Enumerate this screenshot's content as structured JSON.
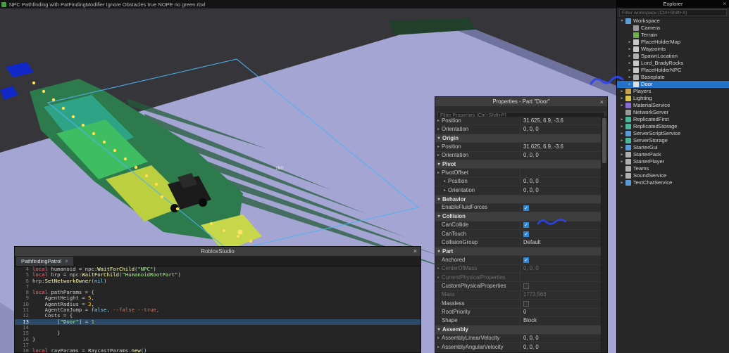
{
  "title_bar": {
    "title": "NPC Pathfinding with PatFindingModifier Ignore Obstacles true NOPE no green.rbxl"
  },
  "viewport": {
    "size_label": "160"
  },
  "script_editor": {
    "window_title": "RobloxStudio",
    "close_label": "×",
    "tab_label": "PathfindingPatrol",
    "tab_close": "×",
    "current_line": "13",
    "lines": [
      {
        "n": "4",
        "seg": [
          [
            "local",
            "kw"
          ],
          [
            " humanoid = npc:",
            "pl"
          ],
          [
            "WaitForChild",
            "fn"
          ],
          [
            "(",
            "pl"
          ],
          [
            "\"NPC\"",
            "str"
          ],
          [
            ")",
            "pl"
          ]
        ]
      },
      {
        "n": "5",
        "seg": [
          [
            "local",
            "kw"
          ],
          [
            " hrp = npc:",
            "pl"
          ],
          [
            "WaitForChild",
            "fn"
          ],
          [
            "(",
            "pl"
          ],
          [
            "\"HumanoidRootPart\"",
            "str"
          ],
          [
            ")",
            "pl"
          ]
        ]
      },
      {
        "n": "6",
        "seg": [
          [
            "hrp:",
            "pl"
          ],
          [
            "SetNetworkOwner",
            "fn"
          ],
          [
            "(",
            "pl"
          ],
          [
            "nil",
            "bool"
          ],
          [
            ")",
            "pl"
          ]
        ]
      },
      {
        "n": "7",
        "seg": [
          [
            "",
            "pl"
          ]
        ]
      },
      {
        "n": "8",
        "seg": [
          [
            "local",
            "kw"
          ],
          [
            " pathParams = {",
            "pl"
          ]
        ]
      },
      {
        "n": "9",
        "seg": [
          [
            "    AgentHeight = ",
            "pl"
          ],
          [
            "5",
            "num"
          ],
          [
            ",",
            "pl"
          ]
        ]
      },
      {
        "n": "10",
        "seg": [
          [
            "    AgentRadius = ",
            "pl"
          ],
          [
            "3",
            "num"
          ],
          [
            ",",
            "pl"
          ]
        ]
      },
      {
        "n": "11",
        "seg": [
          [
            "    AgentCanJump = ",
            "pl"
          ],
          [
            "false",
            "bool"
          ],
          [
            ", ",
            "pl"
          ],
          [
            "--false --true,",
            "com"
          ]
        ]
      },
      {
        "n": "12",
        "seg": [
          [
            "    Costs = {",
            "pl"
          ]
        ]
      },
      {
        "n": "13",
        "seg": [
          [
            "        [",
            "pl"
          ],
          [
            "\"Door\"",
            "str"
          ],
          [
            "] = ",
            "pl"
          ],
          [
            "1",
            "num"
          ]
        ]
      },
      {
        "n": "14",
        "seg": [
          [
            "",
            "pl"
          ]
        ]
      },
      {
        "n": "15",
        "seg": [
          [
            "        }",
            "pl"
          ]
        ]
      },
      {
        "n": "16",
        "seg": [
          [
            "}",
            "pl"
          ]
        ]
      },
      {
        "n": "17",
        "seg": [
          [
            "",
            "pl"
          ]
        ]
      },
      {
        "n": "18",
        "seg": [
          [
            "local",
            "kw"
          ],
          [
            " rayParams = RaycastParams.",
            "pl"
          ],
          [
            "new",
            "fn"
          ],
          [
            "()",
            "pl"
          ]
        ]
      }
    ]
  },
  "properties_panel": {
    "title": "Properties - Part \"Door\"",
    "close_label": "×",
    "filter_placeholder": "Filter Properties (Ctrl+Shift+P)",
    "rows": [
      {
        "t": "p",
        "name": "Position",
        "val": "31.625, 6.9, -3.6",
        "arr": true
      },
      {
        "t": "p",
        "name": "Orientation",
        "val": "0, 0, 0",
        "arr": true
      },
      {
        "t": "s",
        "name": "Origin"
      },
      {
        "t": "p",
        "name": "Position",
        "val": "31.625, 6.9, -3.6",
        "arr": true
      },
      {
        "t": "p",
        "name": "Orientation",
        "val": "0, 0, 0",
        "arr": true
      },
      {
        "t": "s",
        "name": "Pivot"
      },
      {
        "t": "p",
        "name": "PivotOffset",
        "val": "",
        "arr": true
      },
      {
        "t": "p",
        "name": "Position",
        "val": "0, 0, 0",
        "arr": true,
        "ind": 1
      },
      {
        "t": "p",
        "name": "Orientation",
        "val": "0, 0, 0",
        "arr": true,
        "ind": 1
      },
      {
        "t": "s",
        "name": "Behavior"
      },
      {
        "t": "p",
        "name": "EnableFluidForces",
        "chk": true
      },
      {
        "t": "s",
        "name": "Collision"
      },
      {
        "t": "p",
        "name": "CanCollide",
        "chk": true
      },
      {
        "t": "p",
        "name": "CanTouch",
        "chk": true
      },
      {
        "t": "p",
        "name": "CollisionGroup",
        "val": "Default"
      },
      {
        "t": "s",
        "name": "Part"
      },
      {
        "t": "p",
        "name": "Anchored",
        "chk": true
      },
      {
        "t": "p",
        "name": "CenterOfMass",
        "val": "0, 0, 0",
        "arr": true,
        "gray": true
      },
      {
        "t": "p",
        "name": "CurrentPhysicalProperties",
        "val": "",
        "arr": true,
        "gray": true
      },
      {
        "t": "p",
        "name": "CustomPhysicalProperties",
        "chk": false
      },
      {
        "t": "p",
        "name": "Mass",
        "val": "1773.563",
        "gray": true
      },
      {
        "t": "p",
        "name": "Massless",
        "chk": false
      },
      {
        "t": "p",
        "name": "RootPriority",
        "val": "0"
      },
      {
        "t": "p",
        "name": "Shape",
        "val": "Block"
      },
      {
        "t": "s",
        "name": "Assembly"
      },
      {
        "t": "p",
        "name": "AssemblyLinearVelocity",
        "val": "0, 0, 0",
        "arr": true
      },
      {
        "t": "p",
        "name": "AssemblyAngularVelocity",
        "val": "0, 0, 0",
        "arr": true
      }
    ]
  },
  "explorer": {
    "title": "Explorer",
    "close_label": "×",
    "filter_placeholder": "Filter workspace (Ctrl+Shift+X)",
    "items": [
      {
        "label": "Workspace",
        "ind": 0,
        "arr": "d",
        "ic": "workspace-icon",
        "c": "#58a0d6"
      },
      {
        "label": "Camera",
        "ind": 1,
        "arr": "",
        "ic": "camera-icon",
        "c": "#9a9a9a"
      },
      {
        "label": "Terrain",
        "ind": 1,
        "arr": "",
        "ic": "terrain-icon",
        "c": "#6fae4e"
      },
      {
        "label": "PlaceHolderMap",
        "ind": 1,
        "arr": "r",
        "ic": "model-icon",
        "c": "#c8c8c8"
      },
      {
        "label": "Waypoints",
        "ind": 1,
        "arr": "r",
        "ic": "model-icon",
        "c": "#c8c8c8"
      },
      {
        "label": "SpawnLocation",
        "ind": 1,
        "arr": "r",
        "ic": "spawn-location-icon",
        "c": "#b0b0b0"
      },
      {
        "label": "Lord_BradyRocks",
        "ind": 1,
        "arr": "r",
        "ic": "model-icon",
        "c": "#c8c8c8"
      },
      {
        "label": "PlaceHolderNPC",
        "ind": 1,
        "arr": "r",
        "ic": "model-icon",
        "c": "#c8c8c8"
      },
      {
        "label": "Baseplate",
        "ind": 1,
        "arr": "r",
        "ic": "part-icon",
        "c": "#b0b0b0"
      },
      {
        "label": "Door",
        "ind": 1,
        "arr": "r",
        "ic": "part-icon",
        "c": "#e0e0e0",
        "sel": true
      },
      {
        "label": "Players",
        "ind": 0,
        "arr": "r",
        "ic": "players-icon",
        "c": "#c8a24a"
      },
      {
        "label": "Lighting",
        "ind": 0,
        "arr": "r",
        "ic": "lighting-icon",
        "c": "#d6c44e"
      },
      {
        "label": "MaterialService",
        "ind": 0,
        "arr": "r",
        "ic": "material-service-icon",
        "c": "#8a6ad6"
      },
      {
        "label": "NetworkServer",
        "ind": 0,
        "arr": "",
        "ic": "network-server-icon",
        "c": "#9a9a9a"
      },
      {
        "label": "ReplicatedFirst",
        "ind": 0,
        "arr": "r",
        "ic": "replicated-first-icon",
        "c": "#49b89a"
      },
      {
        "label": "ReplicatedStorage",
        "ind": 0,
        "arr": "r",
        "ic": "replicated-storage-icon",
        "c": "#49b89a"
      },
      {
        "label": "ServerScriptService",
        "ind": 0,
        "arr": "r",
        "ic": "server-script-service-icon",
        "c": "#5a9ad8"
      },
      {
        "label": "ServerStorage",
        "ind": 0,
        "arr": "r",
        "ic": "server-storage-icon",
        "c": "#49b89a"
      },
      {
        "label": "StarterGui",
        "ind": 0,
        "arr": "r",
        "ic": "starter-gui-icon",
        "c": "#5a9ad8"
      },
      {
        "label": "StarterPack",
        "ind": 0,
        "arr": "r",
        "ic": "starter-pack-icon",
        "c": "#b0b0b0"
      },
      {
        "label": "StarterPlayer",
        "ind": 0,
        "arr": "r",
        "ic": "starter-player-icon",
        "c": "#b0b0b0"
      },
      {
        "label": "Teams",
        "ind": 0,
        "arr": "",
        "ic": "teams-icon",
        "c": "#b0b0b0"
      },
      {
        "label": "SoundService",
        "ind": 0,
        "arr": "r",
        "ic": "sound-service-icon",
        "c": "#b0b0b0"
      },
      {
        "label": "TextChatService",
        "ind": 0,
        "arr": "r",
        "ic": "text-chat-service-icon",
        "c": "#5a9ad8"
      }
    ]
  },
  "annotations": {
    "scribble_color": "#2a46f0"
  }
}
